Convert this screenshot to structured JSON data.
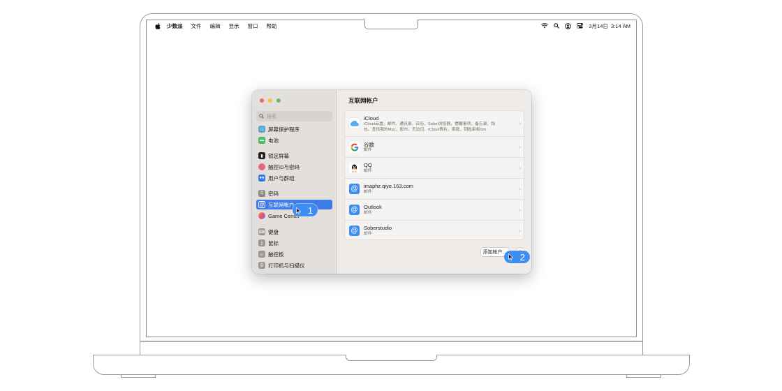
{
  "menubar": {
    "app_name": "少数派",
    "items": [
      "文件",
      "编辑",
      "显示",
      "窗口",
      "帮助"
    ],
    "clock": "3月14日  3:14 AM"
  },
  "search": {
    "placeholder": "搜索"
  },
  "sidebar": {
    "items": [
      {
        "label": "屏幕保护程序",
        "icon": "screensaver-icon",
        "color": "#5aa7d6"
      },
      {
        "label": "电池",
        "icon": "battery-icon",
        "color": "#4bbf5e"
      },
      {
        "label": "锁定屏幕",
        "icon": "lock-screen-icon",
        "color": "#222222"
      },
      {
        "label": "触控ID与密码",
        "icon": "touch-id-icon",
        "color": "#e36a7c"
      },
      {
        "label": "用户与群组",
        "icon": "users-groups-icon",
        "color": "#3d7ce8"
      },
      {
        "label": "密码",
        "icon": "password-key-icon",
        "color": "#8e8a86"
      },
      {
        "label": "互联网帐户",
        "icon": "internet-accounts-icon",
        "color": "#3d7ce8"
      },
      {
        "label": "Game Center",
        "icon": "game-center-icon",
        "color": "#e84c7a"
      },
      {
        "label": "键盘",
        "icon": "keyboard-icon",
        "color": "#9a9692"
      },
      {
        "label": "鼠标",
        "icon": "mouse-icon",
        "color": "#9a9692"
      },
      {
        "label": "触控板",
        "icon": "trackpad-icon",
        "color": "#9a9692"
      },
      {
        "label": "打印机与扫描仪",
        "icon": "printer-icon",
        "color": "#9a9692"
      }
    ],
    "active_index": 6
  },
  "content": {
    "title": "互联网帐户",
    "accounts": [
      {
        "name": "iCloud",
        "sub_line1": "iCloud云盘、邮件、通讯录、日历、Safari浏览器、提醒事项、备忘录、钱",
        "sub_line2": "包、查找我的Mac、股市、无边记、iCloud照片、家庭、钥匙串和Siri",
        "icon": "icloud-icon"
      },
      {
        "name": "谷歌",
        "sub_line1": "邮件",
        "icon": "google-icon"
      },
      {
        "name": "QQ",
        "sub_line1": "邮件",
        "icon": "qq-icon"
      },
      {
        "name": "imaphz.qiye.163.com",
        "sub_line1": "邮件",
        "icon": "mail-at-icon"
      },
      {
        "name": "Outlook",
        "sub_line1": "邮件",
        "icon": "mail-at-icon"
      },
      {
        "name": "Soberstudio",
        "sub_line1": "邮件",
        "icon": "mail-at-icon"
      }
    ],
    "add_account_label": "添加帐户…",
    "help_label": "?"
  },
  "callouts": [
    "1",
    "2"
  ],
  "colors": {
    "accent": "#3d7ce8",
    "callout": "#3d8ef0"
  }
}
